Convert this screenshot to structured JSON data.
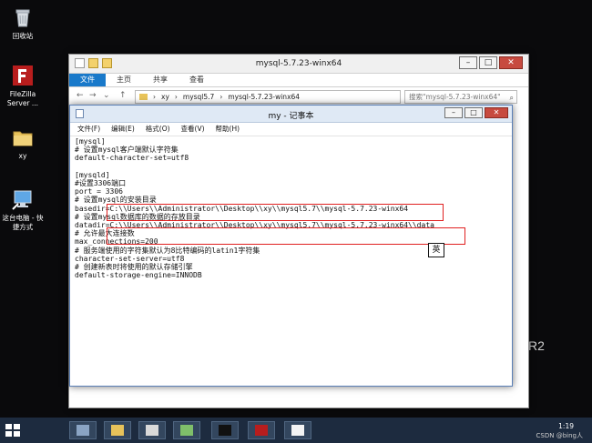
{
  "desktop": {
    "icons": [
      {
        "label": "回收站"
      },
      {
        "label": "FileZilla Server ..."
      },
      {
        "label": "xy"
      },
      {
        "label": "这台电脑 - 快捷方式"
      }
    ],
    "watermark": "R2"
  },
  "explorer": {
    "title": "mysql-5.7.23-winx64",
    "ribbon_tabs": [
      "文件",
      "主页",
      "共享",
      "查看"
    ],
    "address": {
      "parts": [
        "xy",
        "mysql5.7",
        "mysql-5.7.23-winx64"
      ]
    },
    "search_placeholder": "搜索\"mysql-5.7.23-winx64\""
  },
  "notepad": {
    "title": "my - 记事本",
    "menu": [
      "文件(F)",
      "编辑(E)",
      "格式(O)",
      "查看(V)",
      "帮助(H)"
    ],
    "content": "[mysql]\n# 设置mysql客户端默认字符集\ndefault-character-set=utf8\n\n[mysqld]\n#设置3306端口\nport = 3306\n# 设置mysql的安装目录\nbasedir=C:\\\\Users\\\\Administrator\\\\Desktop\\\\xy\\\\mysql5.7\\\\mysql-5.7.23-winx64\n# 设置mysql数据库的数据的存放目录\ndatadir=C:\\\\Users\\\\Administrator\\\\Desktop\\\\xy\\\\mysql5.7\\\\mysql-5.7.23-winx64\\\\data\n# 允许最大连接数\nmax_connections=200\n# 服务端使用的字符集默认为8比特编码的latin1字符集\ncharacter-set-server=utf8\n# 创建新表时将使用的默认存储引擎\ndefault-storage-engine=INNODB",
    "ime_indicator": "英"
  },
  "taskbar": {
    "clock": "1:19"
  },
  "page_watermark": "CSDN @bing人"
}
